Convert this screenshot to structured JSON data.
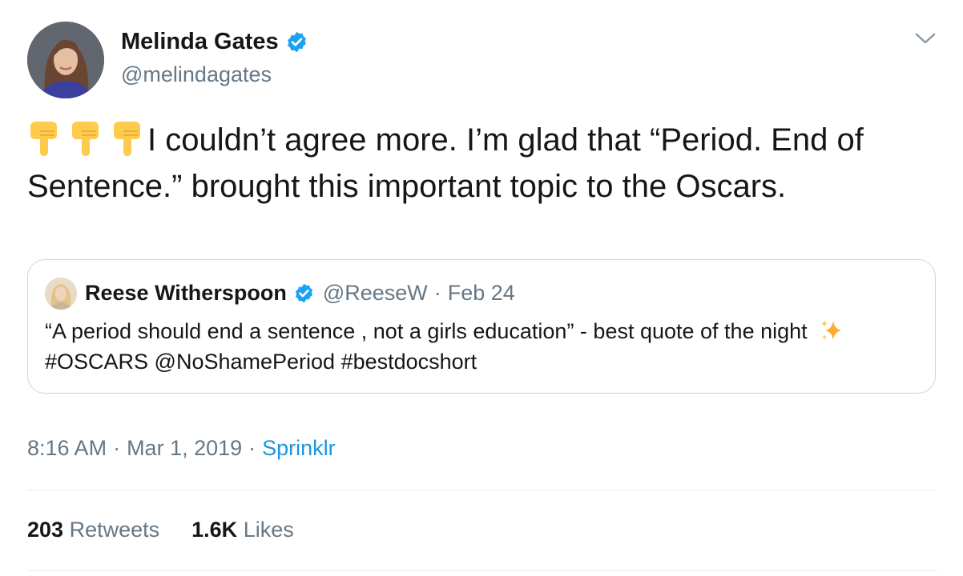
{
  "tweet": {
    "author": {
      "name": "Melinda Gates",
      "handle": "@melindagates",
      "verified": true
    },
    "emojis": [
      "backhand-index-pointing-down",
      "backhand-index-pointing-down",
      "backhand-index-pointing-down"
    ],
    "text": "I couldn’t agree more. I’m glad that “Period. End of Sentence.” brought this important topic to the Oscars.",
    "quoted": {
      "author": {
        "name": "Reese Witherspoon",
        "handle": "@ReeseW",
        "verified": true
      },
      "separator": "·",
      "date": "Feb 24",
      "text_before": "“A period should end a sentence , not a girls education” - best quote of the night",
      "text_after": "#OSCARS @NoShamePeriod #bestdocshort"
    },
    "meta": {
      "time": "8:16 AM",
      "date": "Mar 1, 2019",
      "separator": "·",
      "source": "Sprinklr"
    },
    "stats": {
      "retweets_count": "203",
      "retweets_label": "Retweets",
      "likes_count": "1.6K",
      "likes_label": "Likes"
    }
  },
  "colors": {
    "text": "#14171a",
    "secondary": "#657786",
    "link": "#1b95e0",
    "verified": "#1da1f2",
    "border": "#ccd6dd",
    "divider": "#e6ecf0"
  }
}
